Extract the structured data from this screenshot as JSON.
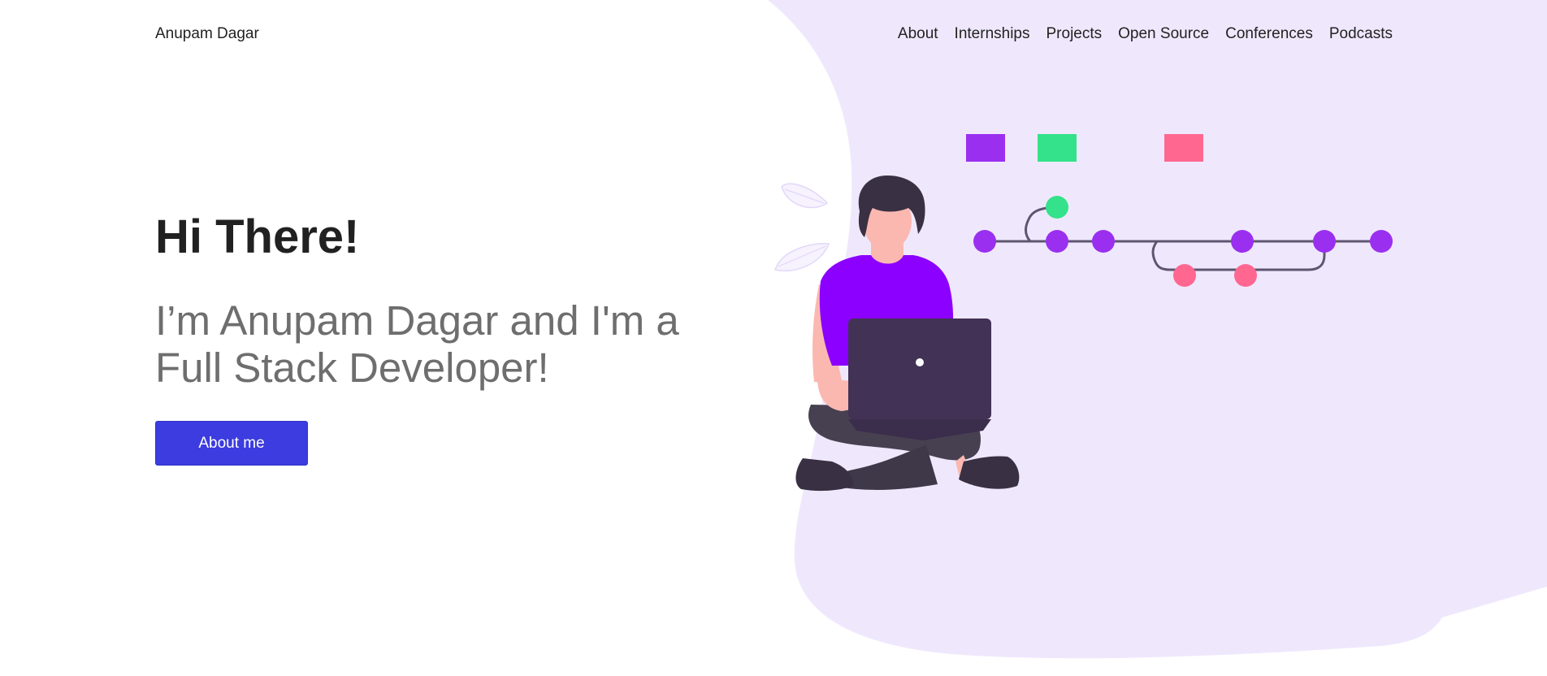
{
  "nav": {
    "brand": "Anupam Dagar",
    "links": [
      {
        "label": "About"
      },
      {
        "label": "Internships"
      },
      {
        "label": "Projects"
      },
      {
        "label": "Open Source"
      },
      {
        "label": "Conferences"
      },
      {
        "label": "Podcasts"
      }
    ]
  },
  "hero": {
    "title": "Hi There!",
    "subtitle_line1": "I’m Anupam Dagar and I'm a",
    "subtitle_line2": "Full Stack Developer!",
    "button_label": "About me"
  },
  "colors": {
    "background_blob": "#efe8fd",
    "button": "#3c3ce0",
    "title_text": "#212121",
    "subtitle_text": "#6e6e6e",
    "commit_purple": "#9a2ff0",
    "commit_green": "#33e28a",
    "commit_pink": "#ff6791",
    "git_line": "#5e5670",
    "shirt": "#8c00ff",
    "laptop": "#423255",
    "hair": "#3a3044",
    "skin": "#fbb8b0",
    "pants": "#474050"
  }
}
